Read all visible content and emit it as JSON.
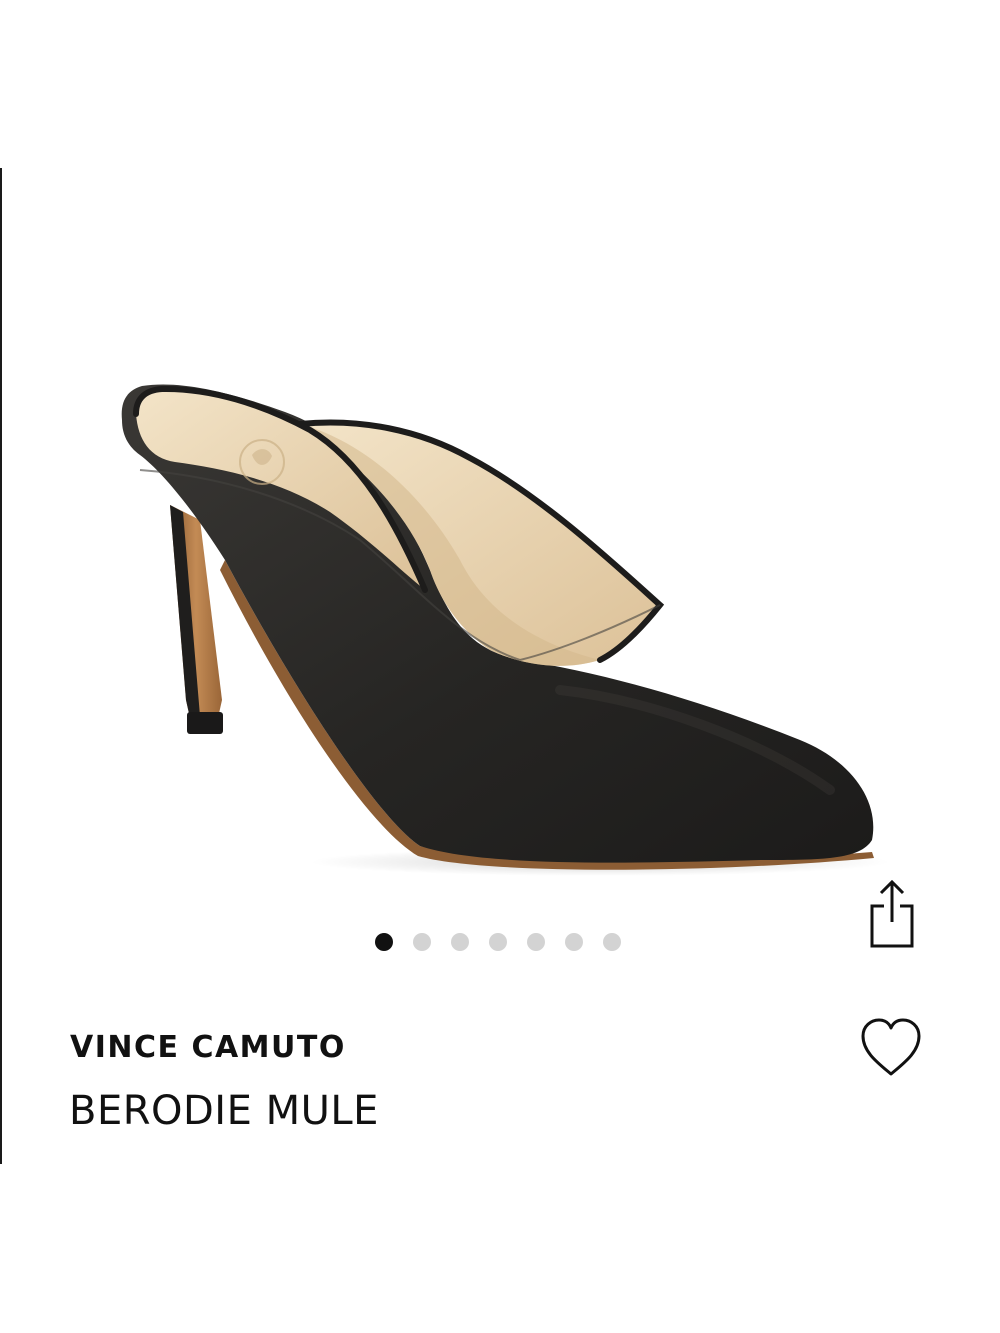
{
  "product": {
    "brand": "VINCE CAMUTO",
    "name": "BERODIE MULE"
  },
  "gallery": {
    "image_count": 7,
    "active_index": 0
  },
  "icons": {
    "share": "share-icon",
    "wishlist": "heart-outline-icon"
  },
  "colors": {
    "dot_active": "#111111",
    "dot_inactive": "#d3d3d3",
    "shoe_upper": "#2b2a28",
    "shoe_lining": "#e8d2ad",
    "heel_wood": "#b07a45"
  }
}
